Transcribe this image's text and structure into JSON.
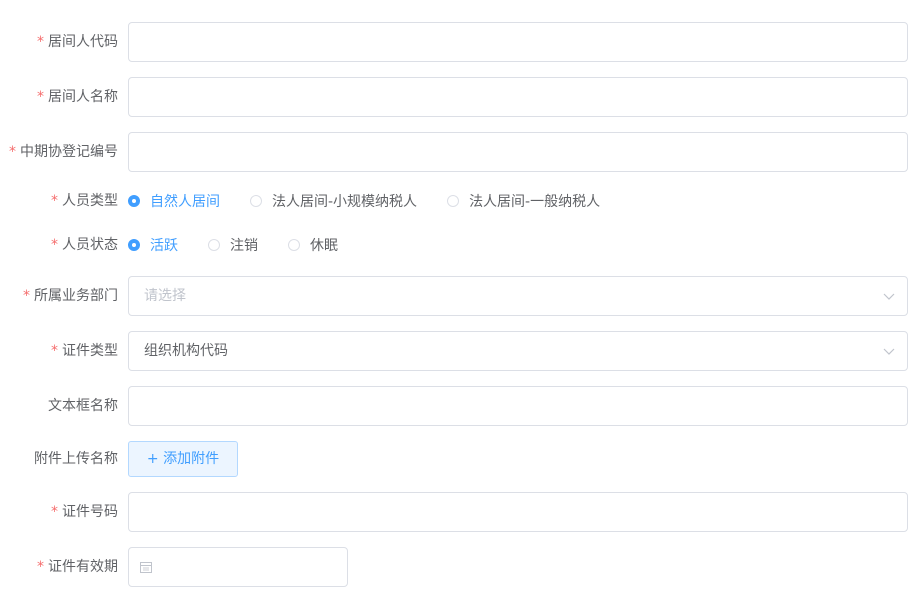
{
  "form": {
    "agent_code": {
      "label": "居间人代码",
      "required": true,
      "value": ""
    },
    "agent_name": {
      "label": "居间人名称",
      "required": true,
      "value": ""
    },
    "cfa_reg_no": {
      "label": "中期协登记编号",
      "required": true,
      "value": ""
    },
    "person_type": {
      "label": "人员类型",
      "required": true,
      "options": [
        "自然人居间",
        "法人居间-小规模纳税人",
        "法人居间-一般纳税人"
      ],
      "selected": "自然人居间"
    },
    "person_status": {
      "label": "人员状态",
      "required": true,
      "options": [
        "活跃",
        "注销",
        "休眠"
      ],
      "selected": "活跃"
    },
    "department": {
      "label": "所属业务部门",
      "required": true,
      "placeholder": "请选择",
      "value": ""
    },
    "cert_type": {
      "label": "证件类型",
      "required": true,
      "value": "组织机构代码"
    },
    "textbox_name": {
      "label": "文本框名称",
      "required": false,
      "value": ""
    },
    "attachment": {
      "label": "附件上传名称",
      "required": false,
      "button_label": "+ 添加附件"
    },
    "cert_no": {
      "label": "证件号码",
      "required": true,
      "value": ""
    },
    "cert_expiry": {
      "label": "证件有效期",
      "required": true,
      "value": ""
    }
  },
  "colors": {
    "accent": "#409eff",
    "required_star": "#f56c6c",
    "border": "#dcdfe6",
    "text": "#606266",
    "placeholder": "#c0c4cc"
  },
  "icons": {
    "select_arrow": "chevron-down-icon",
    "date": "calendar-icon"
  }
}
